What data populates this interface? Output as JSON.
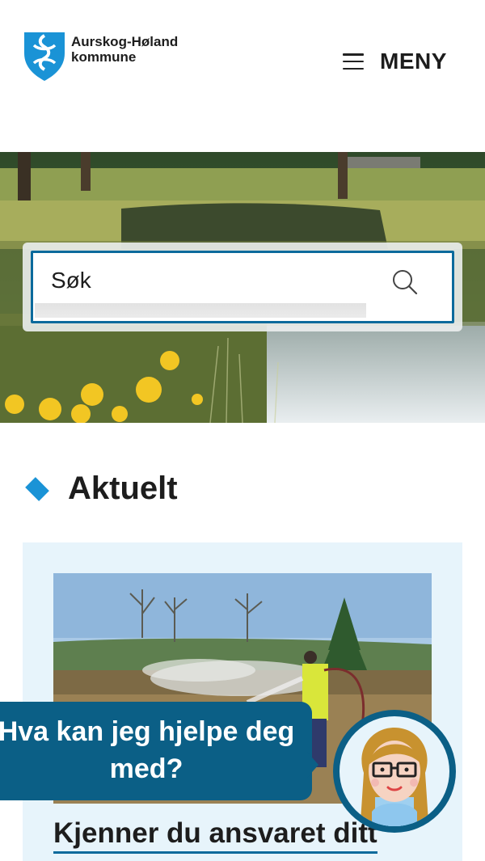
{
  "header": {
    "logo_line1": "Aurskog-Høland",
    "logo_line2": "kommune",
    "menu_label": "MENY"
  },
  "search": {
    "placeholder": "Søk"
  },
  "section": {
    "title": "Aktuelt"
  },
  "news": [
    {
      "title": "Kjenner du ansvaret ditt"
    }
  ],
  "chat": {
    "prompt": "Hva kan jeg hjelpe deg med?"
  },
  "colors": {
    "brand_blue": "#0b6a9c",
    "chat_blue": "#0b5f86",
    "accent": "#1a93d6",
    "card_bg": "#e7f4fb"
  },
  "icons": [
    "municipality-shield-icon",
    "hamburger-menu-icon",
    "search-icon",
    "diamond-bullet-icon",
    "chat-assistant-avatar"
  ]
}
